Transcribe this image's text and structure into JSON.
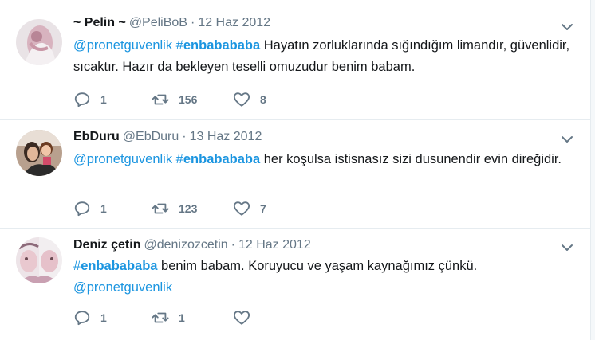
{
  "tweets": [
    {
      "fullname": "~ Pelin ~",
      "username": "@PeliBoB",
      "separator": "·",
      "time": "12 Haz 2012",
      "mention": "@pronetguvenlik",
      "hashtag_hash": "#",
      "hashtag_word": "enbabababa",
      "text_after": " Hayatın zorluklarında sığındığım limandır, güvenlidir, sıcaktır. Hazır da bekleyen teselli omuzudur benim babam.",
      "replies": "1",
      "retweets": "156",
      "likes": "8"
    },
    {
      "fullname": "EbDuru",
      "username": "@EbDuru",
      "separator": "·",
      "time": "13 Haz 2012",
      "mention": "@pronetguvenlik",
      "hashtag_hash": "#",
      "hashtag_word": "enbabababa",
      "text_after": " her koşulsa istisnasız sizi dusunendir evin direğidir.",
      "replies": "1",
      "retweets": "123",
      "likes": "7"
    },
    {
      "fullname": "Deniz çetin",
      "username": "@denizozcetin",
      "separator": "·",
      "time": "12 Haz 2012",
      "hashtag_hash": "#",
      "hashtag_word": "enbabababa",
      "text_mid": " benim babam. Koruyucu ve yaşam kaynağımız çünkü. ",
      "mention": "@pronetguvenlik",
      "replies": "1",
      "retweets": "1",
      "likes": ""
    }
  ],
  "icons": {
    "reply": "reply-icon",
    "retweet": "retweet-icon",
    "like": "heart-icon",
    "menu": "chevron-down-icon"
  },
  "colors": {
    "link": "#1b95e0",
    "secondary": "#657786",
    "divider": "#e6ecf0"
  }
}
